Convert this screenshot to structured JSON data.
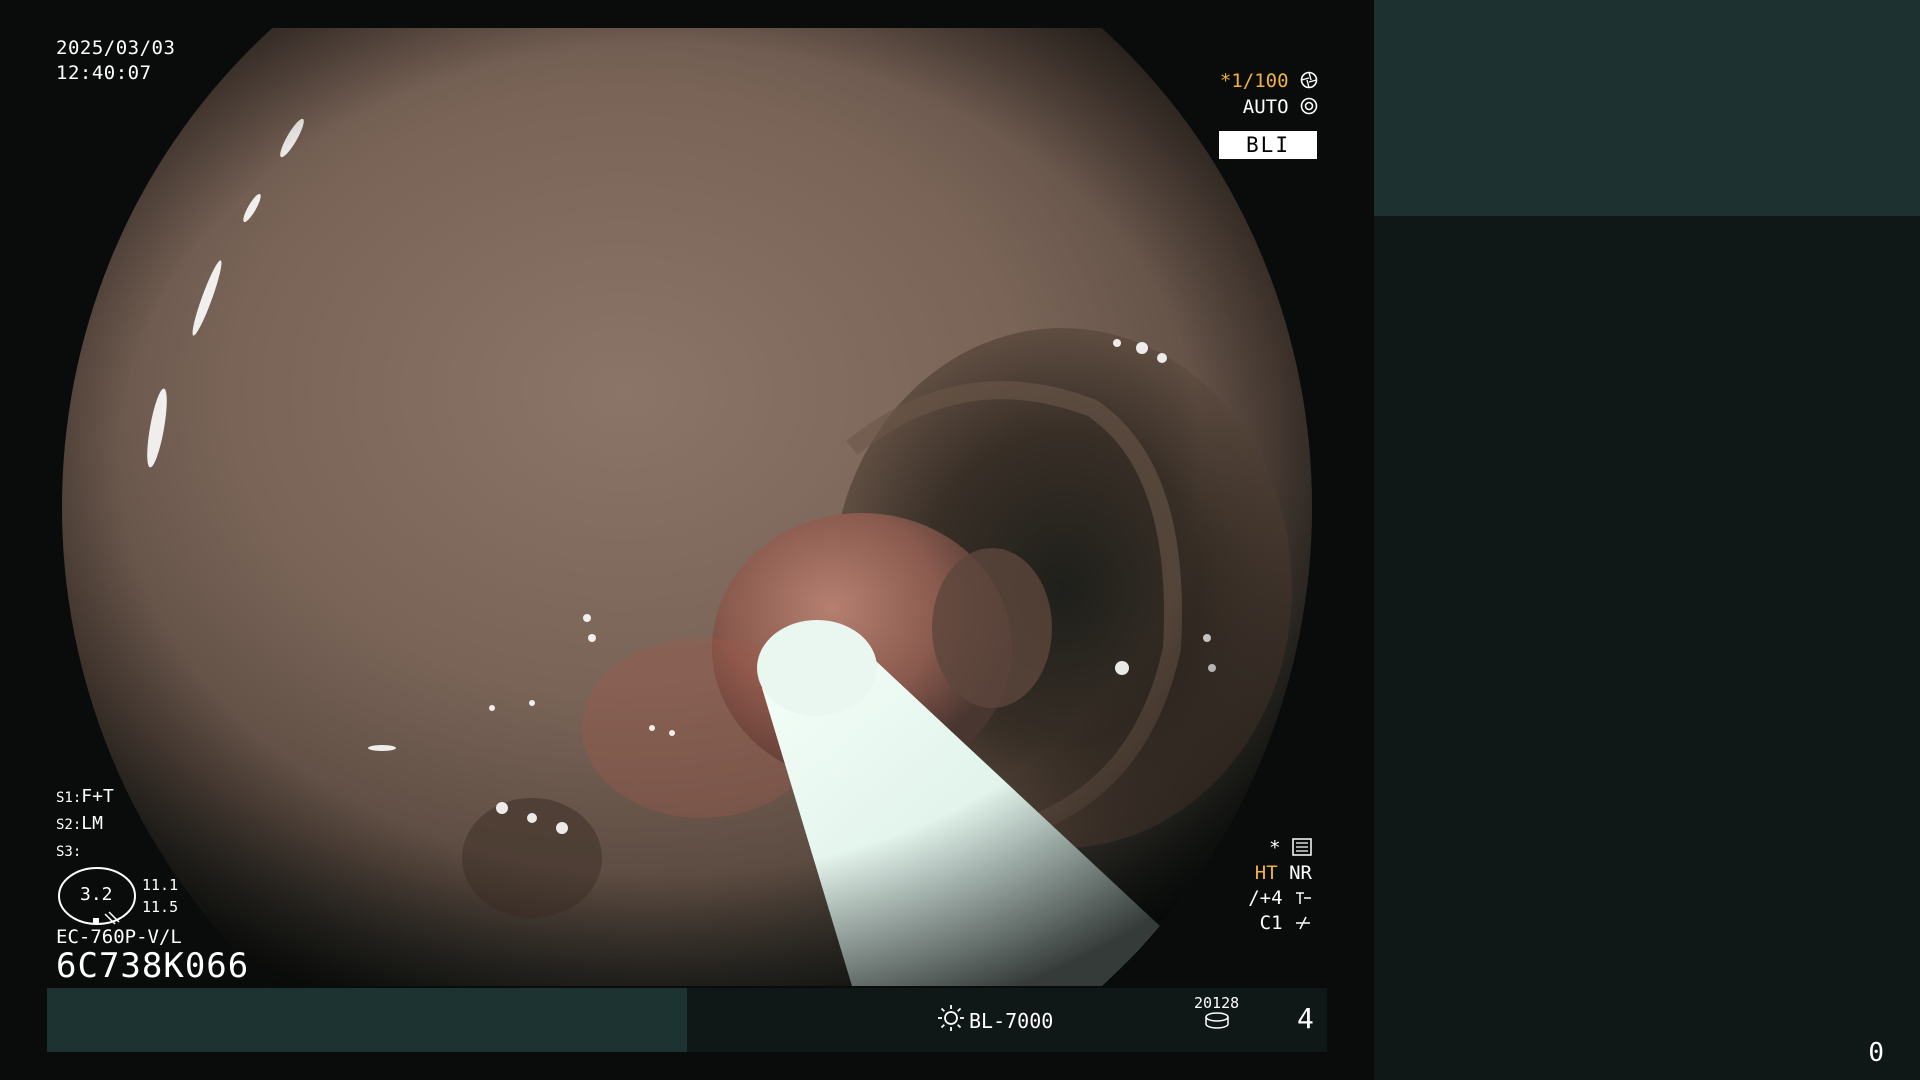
{
  "overlay": {
    "date": "2025/03/03",
    "time": "12:40:07",
    "shutter_prefix": "*1/100",
    "iris_mode": "AUTO",
    "mode_label": "BLI",
    "switch_1": {
      "key": "S1:",
      "value": "F+T"
    },
    "switch_2": {
      "key": "S2:",
      "value": "LM"
    },
    "switch_3": {
      "key": "S3:",
      "value": ""
    },
    "gauge_value": "3.2",
    "gauge_side_top": "11.1",
    "gauge_side_bottom": "11.5",
    "scope_model": "EC-760P-V/L",
    "scope_serial": "6C738K066",
    "status_star": "*",
    "status_ht": "HT",
    "status_nr": "NR",
    "status_enhance": "/+4",
    "status_color": "C1"
  },
  "bottom_bar": {
    "light_source": "BL-7000",
    "image_counter_small": "20128",
    "image_counter_big": "4"
  },
  "side_panel": {
    "count": "0"
  },
  "colors": {
    "accent": "#f0b23a",
    "panel_dark": "#0f1816",
    "panel_teal": "#1c3130"
  },
  "icons": {
    "shutter": "aperture-icon",
    "iris": "iris-icon",
    "menu": "menu-list-icon",
    "light": "sun-icon",
    "storage": "disk-stack-icon"
  }
}
